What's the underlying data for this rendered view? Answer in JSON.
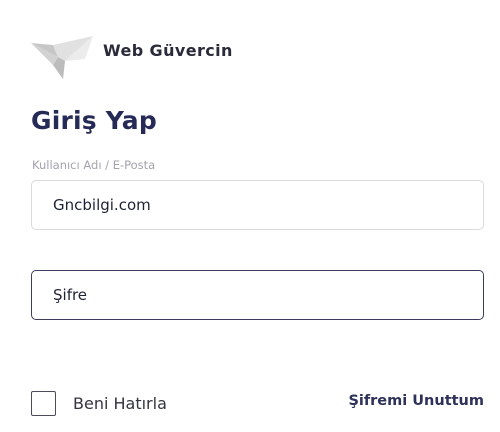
{
  "brand": {
    "logo_icon": "pigeon-logo-icon",
    "name": "Web Güvercin"
  },
  "login": {
    "title": "Giriş Yap",
    "username_label": "Kullanıcı Adı / E-Posta",
    "username_value": "Gncbilgi.com",
    "password_placeholder": "Şifre",
    "remember_label": "Beni Hatırla",
    "remember_checked": false,
    "forgot_link": "Şifremi Unuttum"
  },
  "colors": {
    "title": "#262a56",
    "label": "#a3a3ad",
    "input_border": "#d9d9e0",
    "input_border_active": "#3b3d5c",
    "link": "#2e3158"
  }
}
